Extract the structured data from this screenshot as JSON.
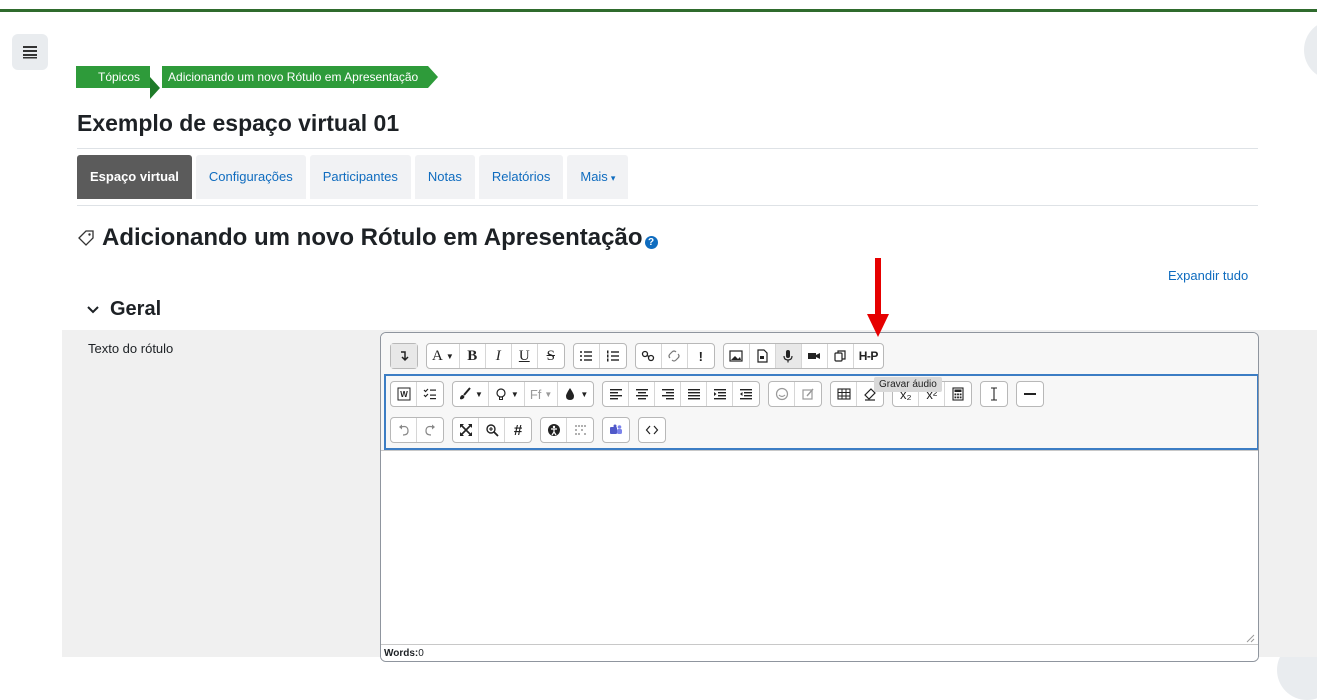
{
  "breadcrumb": {
    "items": [
      "Tópicos",
      "Adicionando um novo Rótulo em Apresentação"
    ]
  },
  "course": {
    "title": "Exemplo de espaço virtual 01"
  },
  "tabs": [
    {
      "label": "Espaço virtual",
      "active": true
    },
    {
      "label": "Configurações"
    },
    {
      "label": "Participantes"
    },
    {
      "label": "Notas"
    },
    {
      "label": "Relatórios"
    },
    {
      "label": "Mais"
    }
  ],
  "page": {
    "heading": "Adicionando um novo Rótulo em Apresentação"
  },
  "form": {
    "expand_all": "Expandir tudo",
    "section_title": "Geral",
    "field_label": "Texto do rótulo"
  },
  "editor": {
    "tooltip": "Gravar áudio",
    "words_label": "Words:",
    "words_count": "0",
    "toolbar_text": {
      "font_a": "A",
      "bold": "B",
      "italic": "I",
      "underline": "U",
      "strike": "S",
      "font_family": "Ff",
      "h5p": "H-P",
      "subscript": "x₂",
      "superscript": "x²",
      "hash": "#"
    }
  },
  "colors": {
    "accent": "#0f6cbf",
    "breadcrumb": "#2e9b3a",
    "annotation": "#e60000",
    "highlight": "#3c7dc4"
  }
}
